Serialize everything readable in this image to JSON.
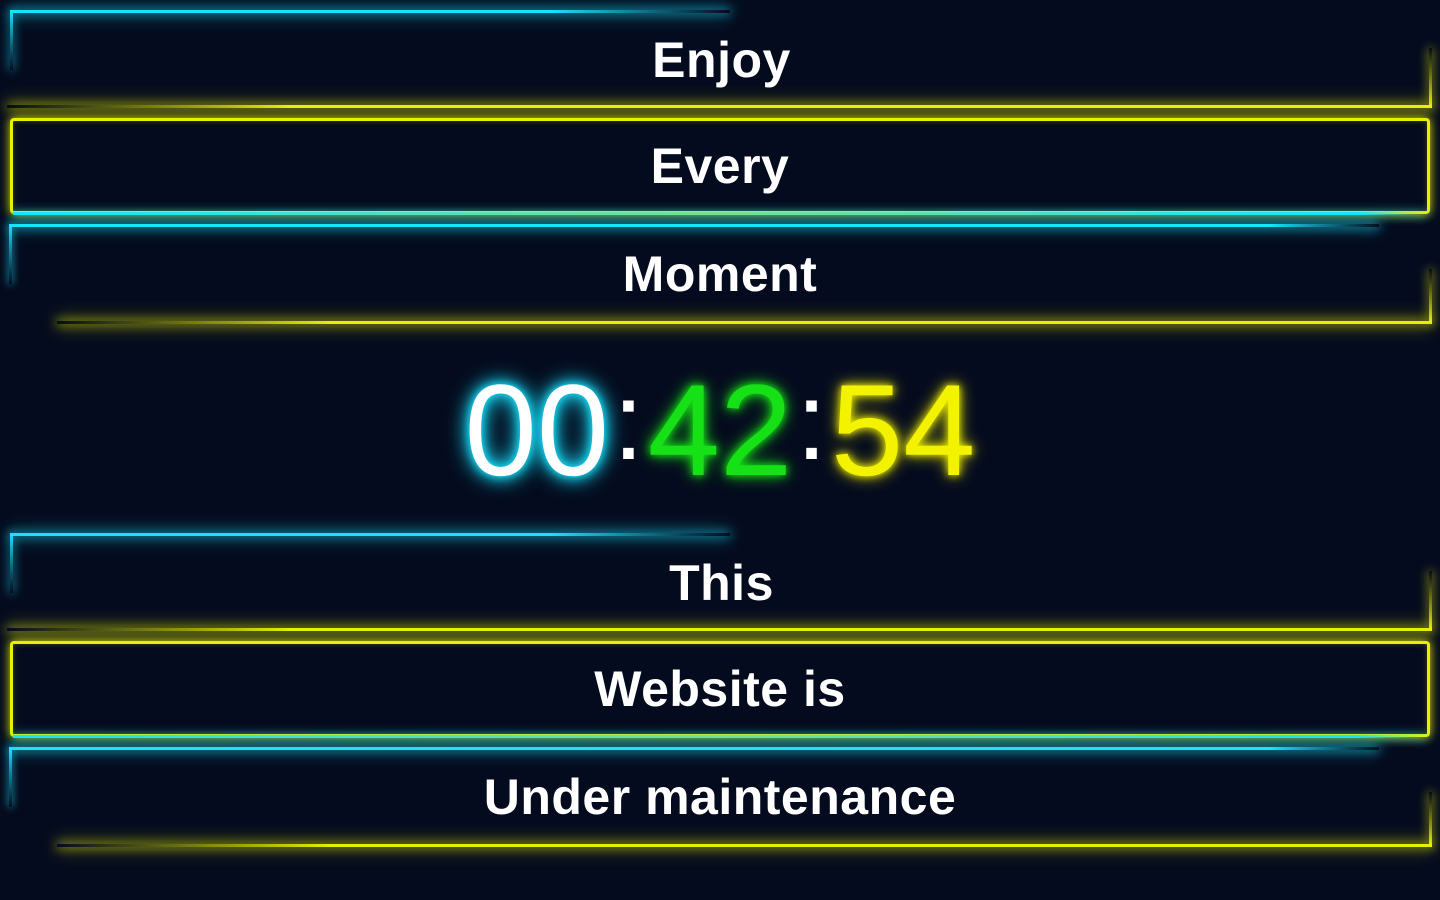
{
  "lines_top": [
    "Enjoy",
    "Every",
    "Moment"
  ],
  "clock": {
    "hours": "00",
    "minutes": "42",
    "seconds": "54",
    "separator": ":"
  },
  "lines_bottom": [
    "This",
    "Website is",
    "Under maintenance"
  ],
  "colors": {
    "background": "#050b1e",
    "cyan": "#19e3ff",
    "green": "#16e016",
    "yellow": "#e8f000",
    "text": "#ffffff"
  }
}
